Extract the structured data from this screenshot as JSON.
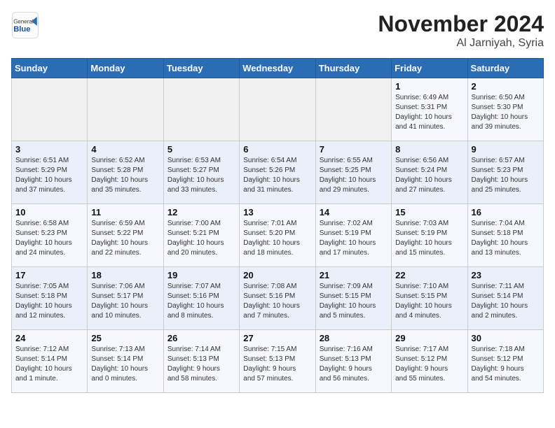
{
  "header": {
    "logo_general": "General",
    "logo_blue": "Blue",
    "month_title": "November 2024",
    "location": "Al Jarniyah, Syria"
  },
  "weekdays": [
    "Sunday",
    "Monday",
    "Tuesday",
    "Wednesday",
    "Thursday",
    "Friday",
    "Saturday"
  ],
  "weeks": [
    [
      {
        "day": "",
        "info": ""
      },
      {
        "day": "",
        "info": ""
      },
      {
        "day": "",
        "info": ""
      },
      {
        "day": "",
        "info": ""
      },
      {
        "day": "",
        "info": ""
      },
      {
        "day": "1",
        "info": "Sunrise: 6:49 AM\nSunset: 5:31 PM\nDaylight: 10 hours\nand 41 minutes."
      },
      {
        "day": "2",
        "info": "Sunrise: 6:50 AM\nSunset: 5:30 PM\nDaylight: 10 hours\nand 39 minutes."
      }
    ],
    [
      {
        "day": "3",
        "info": "Sunrise: 6:51 AM\nSunset: 5:29 PM\nDaylight: 10 hours\nand 37 minutes."
      },
      {
        "day": "4",
        "info": "Sunrise: 6:52 AM\nSunset: 5:28 PM\nDaylight: 10 hours\nand 35 minutes."
      },
      {
        "day": "5",
        "info": "Sunrise: 6:53 AM\nSunset: 5:27 PM\nDaylight: 10 hours\nand 33 minutes."
      },
      {
        "day": "6",
        "info": "Sunrise: 6:54 AM\nSunset: 5:26 PM\nDaylight: 10 hours\nand 31 minutes."
      },
      {
        "day": "7",
        "info": "Sunrise: 6:55 AM\nSunset: 5:25 PM\nDaylight: 10 hours\nand 29 minutes."
      },
      {
        "day": "8",
        "info": "Sunrise: 6:56 AM\nSunset: 5:24 PM\nDaylight: 10 hours\nand 27 minutes."
      },
      {
        "day": "9",
        "info": "Sunrise: 6:57 AM\nSunset: 5:23 PM\nDaylight: 10 hours\nand 25 minutes."
      }
    ],
    [
      {
        "day": "10",
        "info": "Sunrise: 6:58 AM\nSunset: 5:23 PM\nDaylight: 10 hours\nand 24 minutes."
      },
      {
        "day": "11",
        "info": "Sunrise: 6:59 AM\nSunset: 5:22 PM\nDaylight: 10 hours\nand 22 minutes."
      },
      {
        "day": "12",
        "info": "Sunrise: 7:00 AM\nSunset: 5:21 PM\nDaylight: 10 hours\nand 20 minutes."
      },
      {
        "day": "13",
        "info": "Sunrise: 7:01 AM\nSunset: 5:20 PM\nDaylight: 10 hours\nand 18 minutes."
      },
      {
        "day": "14",
        "info": "Sunrise: 7:02 AM\nSunset: 5:19 PM\nDaylight: 10 hours\nand 17 minutes."
      },
      {
        "day": "15",
        "info": "Sunrise: 7:03 AM\nSunset: 5:19 PM\nDaylight: 10 hours\nand 15 minutes."
      },
      {
        "day": "16",
        "info": "Sunrise: 7:04 AM\nSunset: 5:18 PM\nDaylight: 10 hours\nand 13 minutes."
      }
    ],
    [
      {
        "day": "17",
        "info": "Sunrise: 7:05 AM\nSunset: 5:18 PM\nDaylight: 10 hours\nand 12 minutes."
      },
      {
        "day": "18",
        "info": "Sunrise: 7:06 AM\nSunset: 5:17 PM\nDaylight: 10 hours\nand 10 minutes."
      },
      {
        "day": "19",
        "info": "Sunrise: 7:07 AM\nSunset: 5:16 PM\nDaylight: 10 hours\nand 8 minutes."
      },
      {
        "day": "20",
        "info": "Sunrise: 7:08 AM\nSunset: 5:16 PM\nDaylight: 10 hours\nand 7 minutes."
      },
      {
        "day": "21",
        "info": "Sunrise: 7:09 AM\nSunset: 5:15 PM\nDaylight: 10 hours\nand 5 minutes."
      },
      {
        "day": "22",
        "info": "Sunrise: 7:10 AM\nSunset: 5:15 PM\nDaylight: 10 hours\nand 4 minutes."
      },
      {
        "day": "23",
        "info": "Sunrise: 7:11 AM\nSunset: 5:14 PM\nDaylight: 10 hours\nand 2 minutes."
      }
    ],
    [
      {
        "day": "24",
        "info": "Sunrise: 7:12 AM\nSunset: 5:14 PM\nDaylight: 10 hours\nand 1 minute."
      },
      {
        "day": "25",
        "info": "Sunrise: 7:13 AM\nSunset: 5:14 PM\nDaylight: 10 hours\nand 0 minutes."
      },
      {
        "day": "26",
        "info": "Sunrise: 7:14 AM\nSunset: 5:13 PM\nDaylight: 9 hours\nand 58 minutes."
      },
      {
        "day": "27",
        "info": "Sunrise: 7:15 AM\nSunset: 5:13 PM\nDaylight: 9 hours\nand 57 minutes."
      },
      {
        "day": "28",
        "info": "Sunrise: 7:16 AM\nSunset: 5:13 PM\nDaylight: 9 hours\nand 56 minutes."
      },
      {
        "day": "29",
        "info": "Sunrise: 7:17 AM\nSunset: 5:12 PM\nDaylight: 9 hours\nand 55 minutes."
      },
      {
        "day": "30",
        "info": "Sunrise: 7:18 AM\nSunset: 5:12 PM\nDaylight: 9 hours\nand 54 minutes."
      }
    ]
  ]
}
